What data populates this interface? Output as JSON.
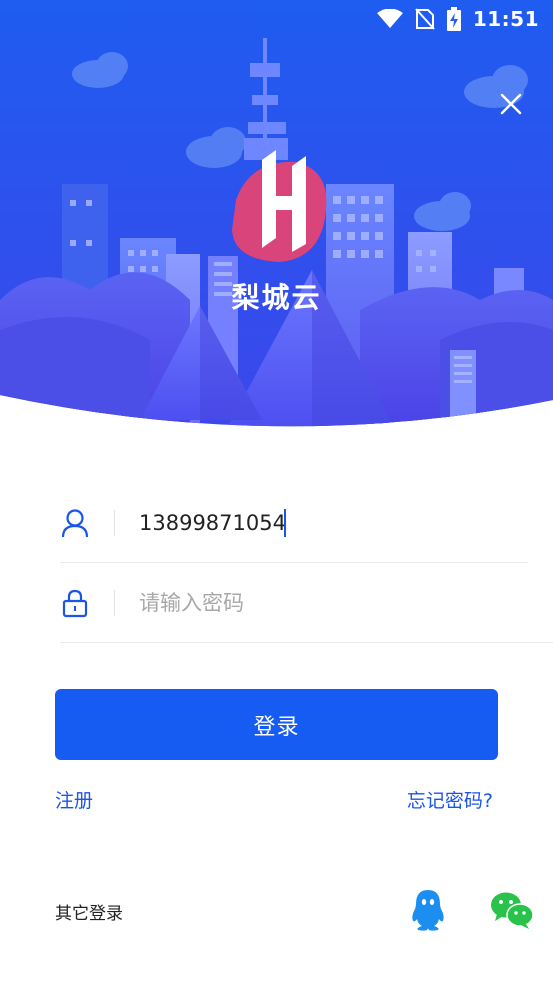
{
  "status_bar": {
    "time": "11:51"
  },
  "app": {
    "name": "梨城云"
  },
  "form": {
    "username_value": "13899871054",
    "password_placeholder": "请输入密码"
  },
  "actions": {
    "login_label": "登录",
    "register_label": "注册",
    "forgot_label": "忘记密码?"
  },
  "other_login": {
    "label": "其它登录"
  },
  "colors": {
    "primary": "#165bf2",
    "hero_top": "#2a52ee",
    "hero_bottom": "#4a3be6"
  }
}
